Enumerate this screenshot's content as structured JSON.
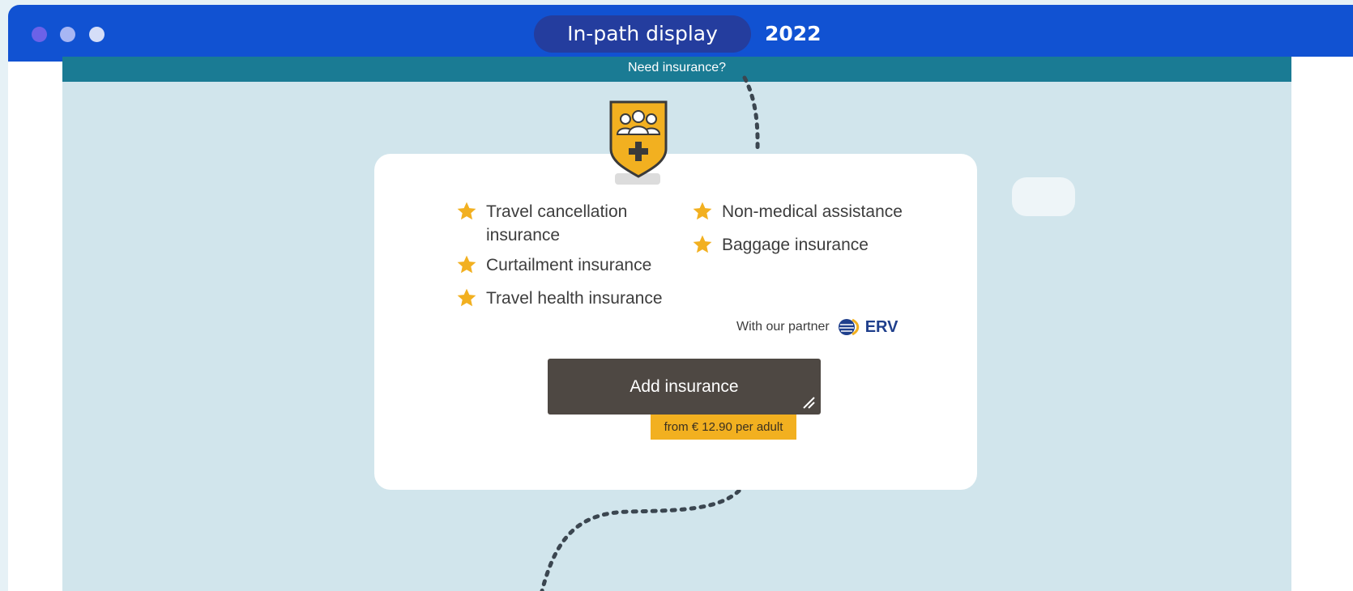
{
  "header": {
    "window_dots": [
      "close-dot",
      "minimize-dot",
      "maximize-dot"
    ],
    "display_label": "In-path display",
    "year": "2022"
  },
  "screenshot": {
    "top_bar_text": "Need insurance?",
    "features": [
      {
        "label_line1": "Travel cancellation",
        "label_line2": "insurance",
        "icon": "star-icon"
      },
      {
        "label_line1": "Curtailment insurance",
        "icon": "star-icon"
      },
      {
        "label_line1": "Travel health insurance",
        "icon": "star-icon"
      },
      {
        "label_line1": "Non-medical assistance",
        "icon": "star-icon"
      },
      {
        "label_line1": "Baggage insurance",
        "icon": "star-icon"
      }
    ],
    "partner_text": "With our partner",
    "partner_name": "ERV",
    "add_button_label": "Add insurance",
    "price_text": "from € 12.90 per adult",
    "badge_icon": "family-shield-icon"
  },
  "colors": {
    "brand_blue": "#1152d2",
    "teal_bar": "#1a7b94",
    "background": "#d1e5ec",
    "star": "#f2b020",
    "button": "#4e4843",
    "price_tag": "#f2b020",
    "erv_blue": "#1f3f8c"
  }
}
